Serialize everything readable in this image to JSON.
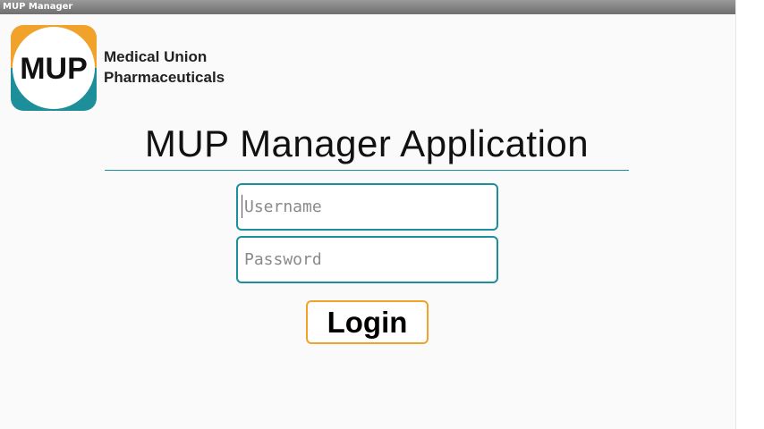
{
  "window": {
    "title": "MUP Manager"
  },
  "branding": {
    "logo_text": "MUP",
    "company_line1": "Medical Union",
    "company_line2": "Pharmaceuticals",
    "colors": {
      "orange": "#f0a22b",
      "teal": "#1c8f9a"
    }
  },
  "login": {
    "heading": "MUP Manager Application",
    "username_placeholder": "Username",
    "password_placeholder": "Password",
    "login_label": "Login"
  }
}
